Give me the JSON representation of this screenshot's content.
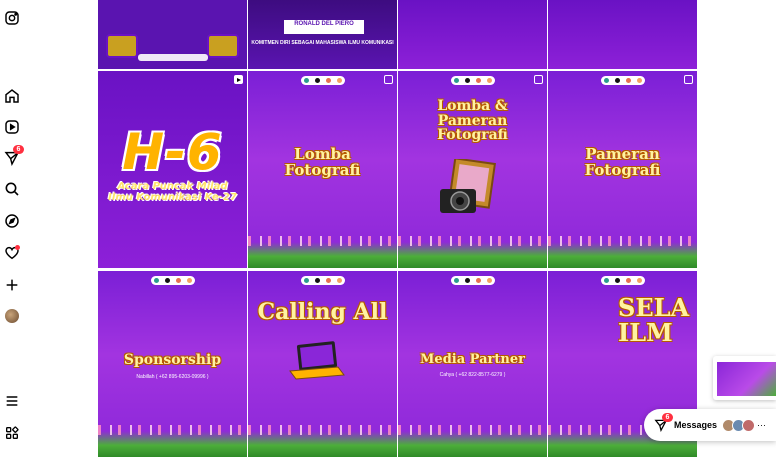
{
  "sidebar": {
    "items": [
      {
        "name": "instagram-logo-icon"
      },
      {
        "name": "home-icon"
      },
      {
        "name": "reels-icon"
      },
      {
        "name": "messages-icon",
        "badge": "6"
      },
      {
        "name": "search-icon"
      },
      {
        "name": "explore-icon"
      },
      {
        "name": "notifications-icon"
      },
      {
        "name": "create-icon"
      },
      {
        "name": "profile-avatar"
      },
      {
        "name": "more-menu-icon"
      },
      {
        "name": "also-from-meta-icon"
      }
    ]
  },
  "posts": {
    "row0": {
      "post2_title": "RONALD DEL PIERO",
      "post2_sub": "KOMITMEN DIRI SEBAGAI MAHASISWA ILMU KOMUNIKASI"
    },
    "row1": {
      "post1_big": "H-6",
      "post1_sub": "Acara Puncak Milad Ilmu Komunikasi Ke-27",
      "post2_title": "Lomba Fotografi",
      "post3_title": "Lomba & Pameran Fotografi",
      "post4_title": "Pameran Fotografi"
    },
    "row2": {
      "post1_title": "Sponsorship",
      "post1_contact": "Nabillah ( +62 895-6203-09996 )",
      "post2_title": "Calling All",
      "post3_title": "Media Partner",
      "post3_contact": "Cahya ( +62 822-8577-6279 )",
      "post4_title": "SELA ILM"
    }
  },
  "messages_bar": {
    "label": "Messages",
    "badge": "6"
  },
  "colors": {
    "accent_purple": "#8a26d8",
    "badge_red": "#ff3040",
    "title_gold": "#ffb300"
  }
}
